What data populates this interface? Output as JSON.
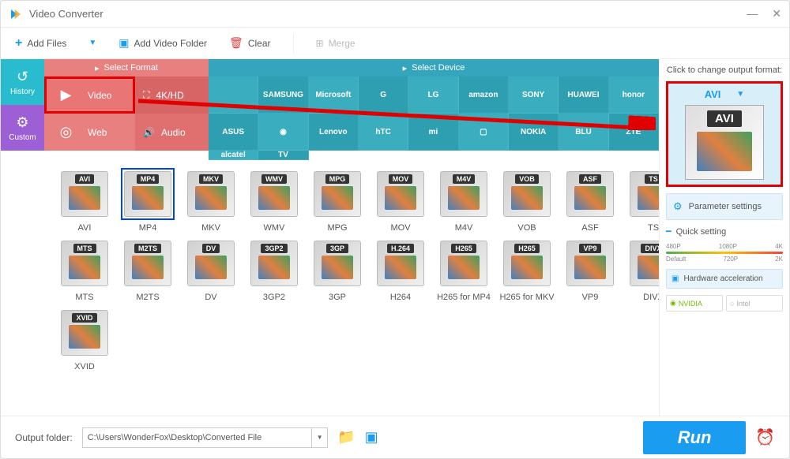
{
  "window": {
    "title": "Video Converter"
  },
  "toolbar": {
    "add_files": "Add Files",
    "add_folder": "Add Video Folder",
    "clear": "Clear",
    "merge": "Merge"
  },
  "sidebar": {
    "history": "History",
    "custom": "Custom"
  },
  "category_tabs": {
    "format": "Select Format",
    "device": "Select Device"
  },
  "format_buttons": {
    "video": "Video",
    "fourkhd": "4K/HD",
    "web": "Web",
    "audio": "Audio"
  },
  "brands": [
    "",
    "SAMSUNG",
    "Microsoft",
    "G",
    "LG",
    "amazon",
    "SONY",
    "HUAWEI",
    "honor",
    "ASUS",
    "",
    "Lenovo",
    "hTC",
    "mi",
    "",
    "NOKIA",
    "BLU",
    "ZTE",
    "alcatel",
    "TV"
  ],
  "formats": [
    {
      "badge": "AVI",
      "label": "AVI"
    },
    {
      "badge": "MP4",
      "label": "MP4",
      "selected": true
    },
    {
      "badge": "MKV",
      "label": "MKV"
    },
    {
      "badge": "WMV",
      "label": "WMV"
    },
    {
      "badge": "MPG",
      "label": "MPG"
    },
    {
      "badge": "MOV",
      "label": "MOV"
    },
    {
      "badge": "M4V",
      "label": "M4V"
    },
    {
      "badge": "VOB",
      "label": "VOB"
    },
    {
      "badge": "ASF",
      "label": "ASF"
    },
    {
      "badge": "TS",
      "label": "TS"
    },
    {
      "badge": "MTS",
      "label": "MTS"
    },
    {
      "badge": "M2TS",
      "label": "M2TS"
    },
    {
      "badge": "DV",
      "label": "DV"
    },
    {
      "badge": "3GP2",
      "label": "3GP2"
    },
    {
      "badge": "3GP",
      "label": "3GP"
    },
    {
      "badge": "H.264",
      "label": "H264"
    },
    {
      "badge": "H265",
      "label": "H265 for MP4"
    },
    {
      "badge": "H265",
      "label": "H265 for MKV"
    },
    {
      "badge": "VP9",
      "label": "VP9"
    },
    {
      "badge": "DIVX",
      "label": "DIVX"
    },
    {
      "badge": "XVID",
      "label": "XVID"
    }
  ],
  "right_panel": {
    "header": "Click to change output format:",
    "selected_format": "AVI",
    "parameter_settings": "Parameter settings",
    "quick_setting": "Quick setting",
    "quality_ticks_top": [
      "480P",
      "1080P",
      "4K"
    ],
    "quality_ticks_bottom": [
      "Default",
      "720P",
      "2K"
    ],
    "hardware_accel": "Hardware acceleration",
    "nvidia": "NVIDIA",
    "intel": "Intel"
  },
  "bottombar": {
    "label": "Output folder:",
    "path": "C:\\Users\\WonderFox\\Desktop\\Converted File",
    "run": "Run"
  }
}
